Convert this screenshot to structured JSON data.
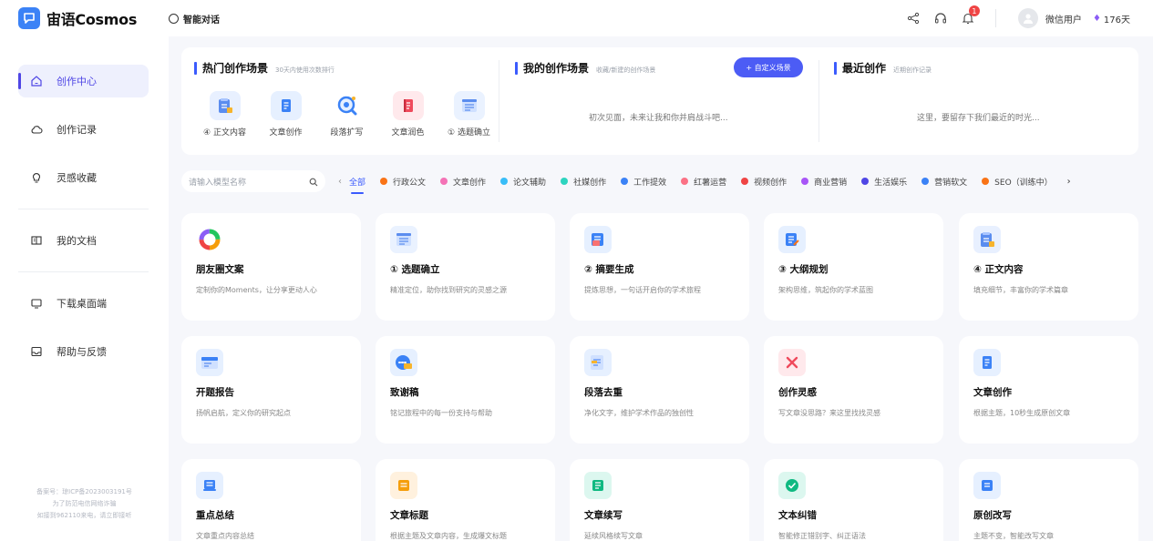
{
  "app": {
    "name": "宙语Cosmos",
    "nav_title": "智能对话"
  },
  "user": {
    "name": "微信用户",
    "days": "176天",
    "notifications": "1"
  },
  "sidebar": {
    "items": [
      {
        "label": "创作中心",
        "icon": "home-icon"
      },
      {
        "label": "创作记录",
        "icon": "cloud-icon"
      },
      {
        "label": "灵感收藏",
        "icon": "bulb-icon"
      },
      {
        "label": "我的文档",
        "icon": "book-icon"
      },
      {
        "label": "下载桌面端",
        "icon": "monitor-icon"
      },
      {
        "label": "帮助与反馈",
        "icon": "feedback-icon"
      }
    ],
    "footer": [
      "备案号：琼ICP备2023003191号",
      "为了防范电信网络诈骗",
      "如接到962110来电，请立即接听"
    ]
  },
  "hot": {
    "title": "热门创作场景",
    "subtitle": "30天内使用次数排行",
    "items": [
      {
        "label": "④ 正文内容",
        "icon": "clipboard-icon",
        "color": "#e8f0ff"
      },
      {
        "label": "文章创作",
        "icon": "book-icon",
        "color": "#e6f0ff"
      },
      {
        "label": "段落扩写",
        "icon": "magnifier-icon",
        "color": "#ffffff"
      },
      {
        "label": "文章润色",
        "icon": "notebook-icon",
        "color": "#ffe9ec"
      },
      {
        "label": "① 选题确立",
        "icon": "list-icon",
        "color": "#eaf2ff"
      }
    ]
  },
  "mine": {
    "title": "我的创作场景",
    "subtitle": "收藏/新建的创作场景",
    "button": "+ 自定义场景",
    "empty": "初次见面，未来让我和你并肩战斗吧..."
  },
  "recent": {
    "title": "最近创作",
    "subtitle": "近期创作记录",
    "empty": "这里，要留存下我们最近的时光..."
  },
  "search": {
    "placeholder": "请输入模型名称"
  },
  "categories": [
    {
      "label": "全部",
      "color": ""
    },
    {
      "label": "行政公文",
      "color": "#f97316"
    },
    {
      "label": "文章创作",
      "color": "#f472b6"
    },
    {
      "label": "论文辅助",
      "color": "#38bdf8"
    },
    {
      "label": "社媒创作",
      "color": "#2dd4bf"
    },
    {
      "label": "工作提效",
      "color": "#3b82f6"
    },
    {
      "label": "红薯运营",
      "color": "#fb7185"
    },
    {
      "label": "视频创作",
      "color": "#ef4444"
    },
    {
      "label": "商业营销",
      "color": "#a855f7"
    },
    {
      "label": "生活娱乐",
      "color": "#4f46e5"
    },
    {
      "label": "营销软文",
      "color": "#3b82f6"
    },
    {
      "label": "SEO（训练中）",
      "color": "#f97316"
    }
  ],
  "cards": [
    {
      "title": "朋友圈文案",
      "desc": "定制你的Moments，让分享更动人心",
      "icon": "ring-icon",
      "color": "#ffffff"
    },
    {
      "title": "① 选题确立",
      "desc": "精准定位，助你找到研究的灵感之源",
      "icon": "list-icon",
      "color": "#eaf2ff"
    },
    {
      "title": "② 摘要生成",
      "desc": "提炼思想，一句话开启你的学术旅程",
      "icon": "summary-icon",
      "color": "#e6f0ff"
    },
    {
      "title": "③ 大纲规划",
      "desc": "架构思维，筑起你的学术蓝图",
      "icon": "outline-icon",
      "color": "#e6f0ff"
    },
    {
      "title": "④ 正文内容",
      "desc": "填充细节，丰富你的学术篇章",
      "icon": "clipboard-icon",
      "color": "#e8f0ff"
    },
    {
      "title": "开题报告",
      "desc": "扬帆启航，定义你的研究起点",
      "icon": "report-icon",
      "color": "#e6f0ff"
    },
    {
      "title": "致谢稿",
      "desc": "铭记旅程中的每一份支持与帮助",
      "icon": "thanks-icon",
      "color": "#e6f0ff"
    },
    {
      "title": "段落去重",
      "desc": "净化文字，维护学术作品的独创性",
      "icon": "dedup-icon",
      "color": "#e6f0ff"
    },
    {
      "title": "创作灵感",
      "desc": "写文章没思路？来这里找找灵感",
      "icon": "spark-icon",
      "color": "#ffe9ec"
    },
    {
      "title": "文章创作",
      "desc": "根据主题，10秒生成原创文章",
      "icon": "book-icon",
      "color": "#e6f0ff"
    },
    {
      "title": "重点总结",
      "desc": "文章重点内容总结",
      "icon": "summary-doc-icon",
      "color": "#e6f0ff"
    },
    {
      "title": "文章标题",
      "desc": "根据主题及文章内容，生成爆文标题",
      "icon": "title-icon",
      "color": "#fff1de"
    },
    {
      "title": "文章续写",
      "desc": "延续风格续写文章",
      "icon": "continue-icon",
      "color": "#dcf7ef"
    },
    {
      "title": "文本纠错",
      "desc": "智能修正错别字、纠正语法",
      "icon": "check-icon",
      "color": "#dcf7ef"
    },
    {
      "title": "原创改写",
      "desc": "主题不变，智能改写文章",
      "icon": "rewrite-icon",
      "color": "#e6f0ff"
    }
  ]
}
